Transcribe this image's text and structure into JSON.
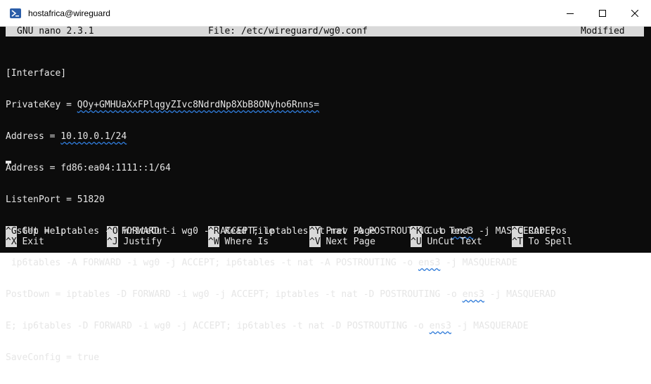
{
  "window": {
    "title": "hostafrica@wireguard"
  },
  "nano_header": {
    "version": "GNU nano 2.3.1",
    "file": "File: /etc/wireguard/wg0.conf",
    "status": "Modified"
  },
  "editor_lines": [
    "[Interface]",
    "PrivateKey = QOy+GMHUaXxFPlqgyZIvc8NdrdNp8XbB8ONyho6Rnns=",
    "Address = 10.10.0.1/24",
    "Address = fd86:ea04:1111::1/64",
    "ListenPort = 51820",
    "PostUp = iptables -A FORWARD -i wg0 -j ACCEPT; iptables -t nat -A POSTROUTING -o ens3 -j MASQUERADE;",
    " ip6tables -A FORWARD -i wg0 -j ACCEPT; ip6tables -t nat -A POSTROUTING -o ens3 -j MASQUERADE",
    "PostDown = iptables -D FORWARD -i wg0 -j ACCEPT; iptables -t nat -D POSTROUTING -o ens3 -j MASQUERAD",
    "E; ip6tables -D FORWARD -i wg0 -j ACCEPT; ip6tables -t nat -D POSTROUTING -o ens3 -j MASQUERADE",
    "SaveConfig = true"
  ],
  "shortcuts": [
    {
      "key": "^G",
      "label": "Get Help"
    },
    {
      "key": "^O",
      "label": "WriteOut"
    },
    {
      "key": "^R",
      "label": "Read File"
    },
    {
      "key": "^Y",
      "label": "Prev Page"
    },
    {
      "key": "^K",
      "label": "Cut Text"
    },
    {
      "key": "^C",
      "label": "Cur Pos"
    },
    {
      "key": "^X",
      "label": "Exit"
    },
    {
      "key": "^J",
      "label": "Justify"
    },
    {
      "key": "^W",
      "label": "Where Is"
    },
    {
      "key": "^V",
      "label": "Next Page"
    },
    {
      "key": "^U",
      "label": "UnCut Text"
    },
    {
      "key": "^T",
      "label": "To Spell"
    }
  ],
  "icons": {
    "app": "powershell-icon",
    "minimize": "minimize-icon",
    "maximize": "maximize-icon",
    "close": "close-icon"
  },
  "colors": {
    "terminal_bg": "#0c0c0c",
    "terminal_fg": "#e6e6e6",
    "highlight_bar": "#d9d9d9",
    "spellcheck_underline": "#2f7bd9"
  }
}
